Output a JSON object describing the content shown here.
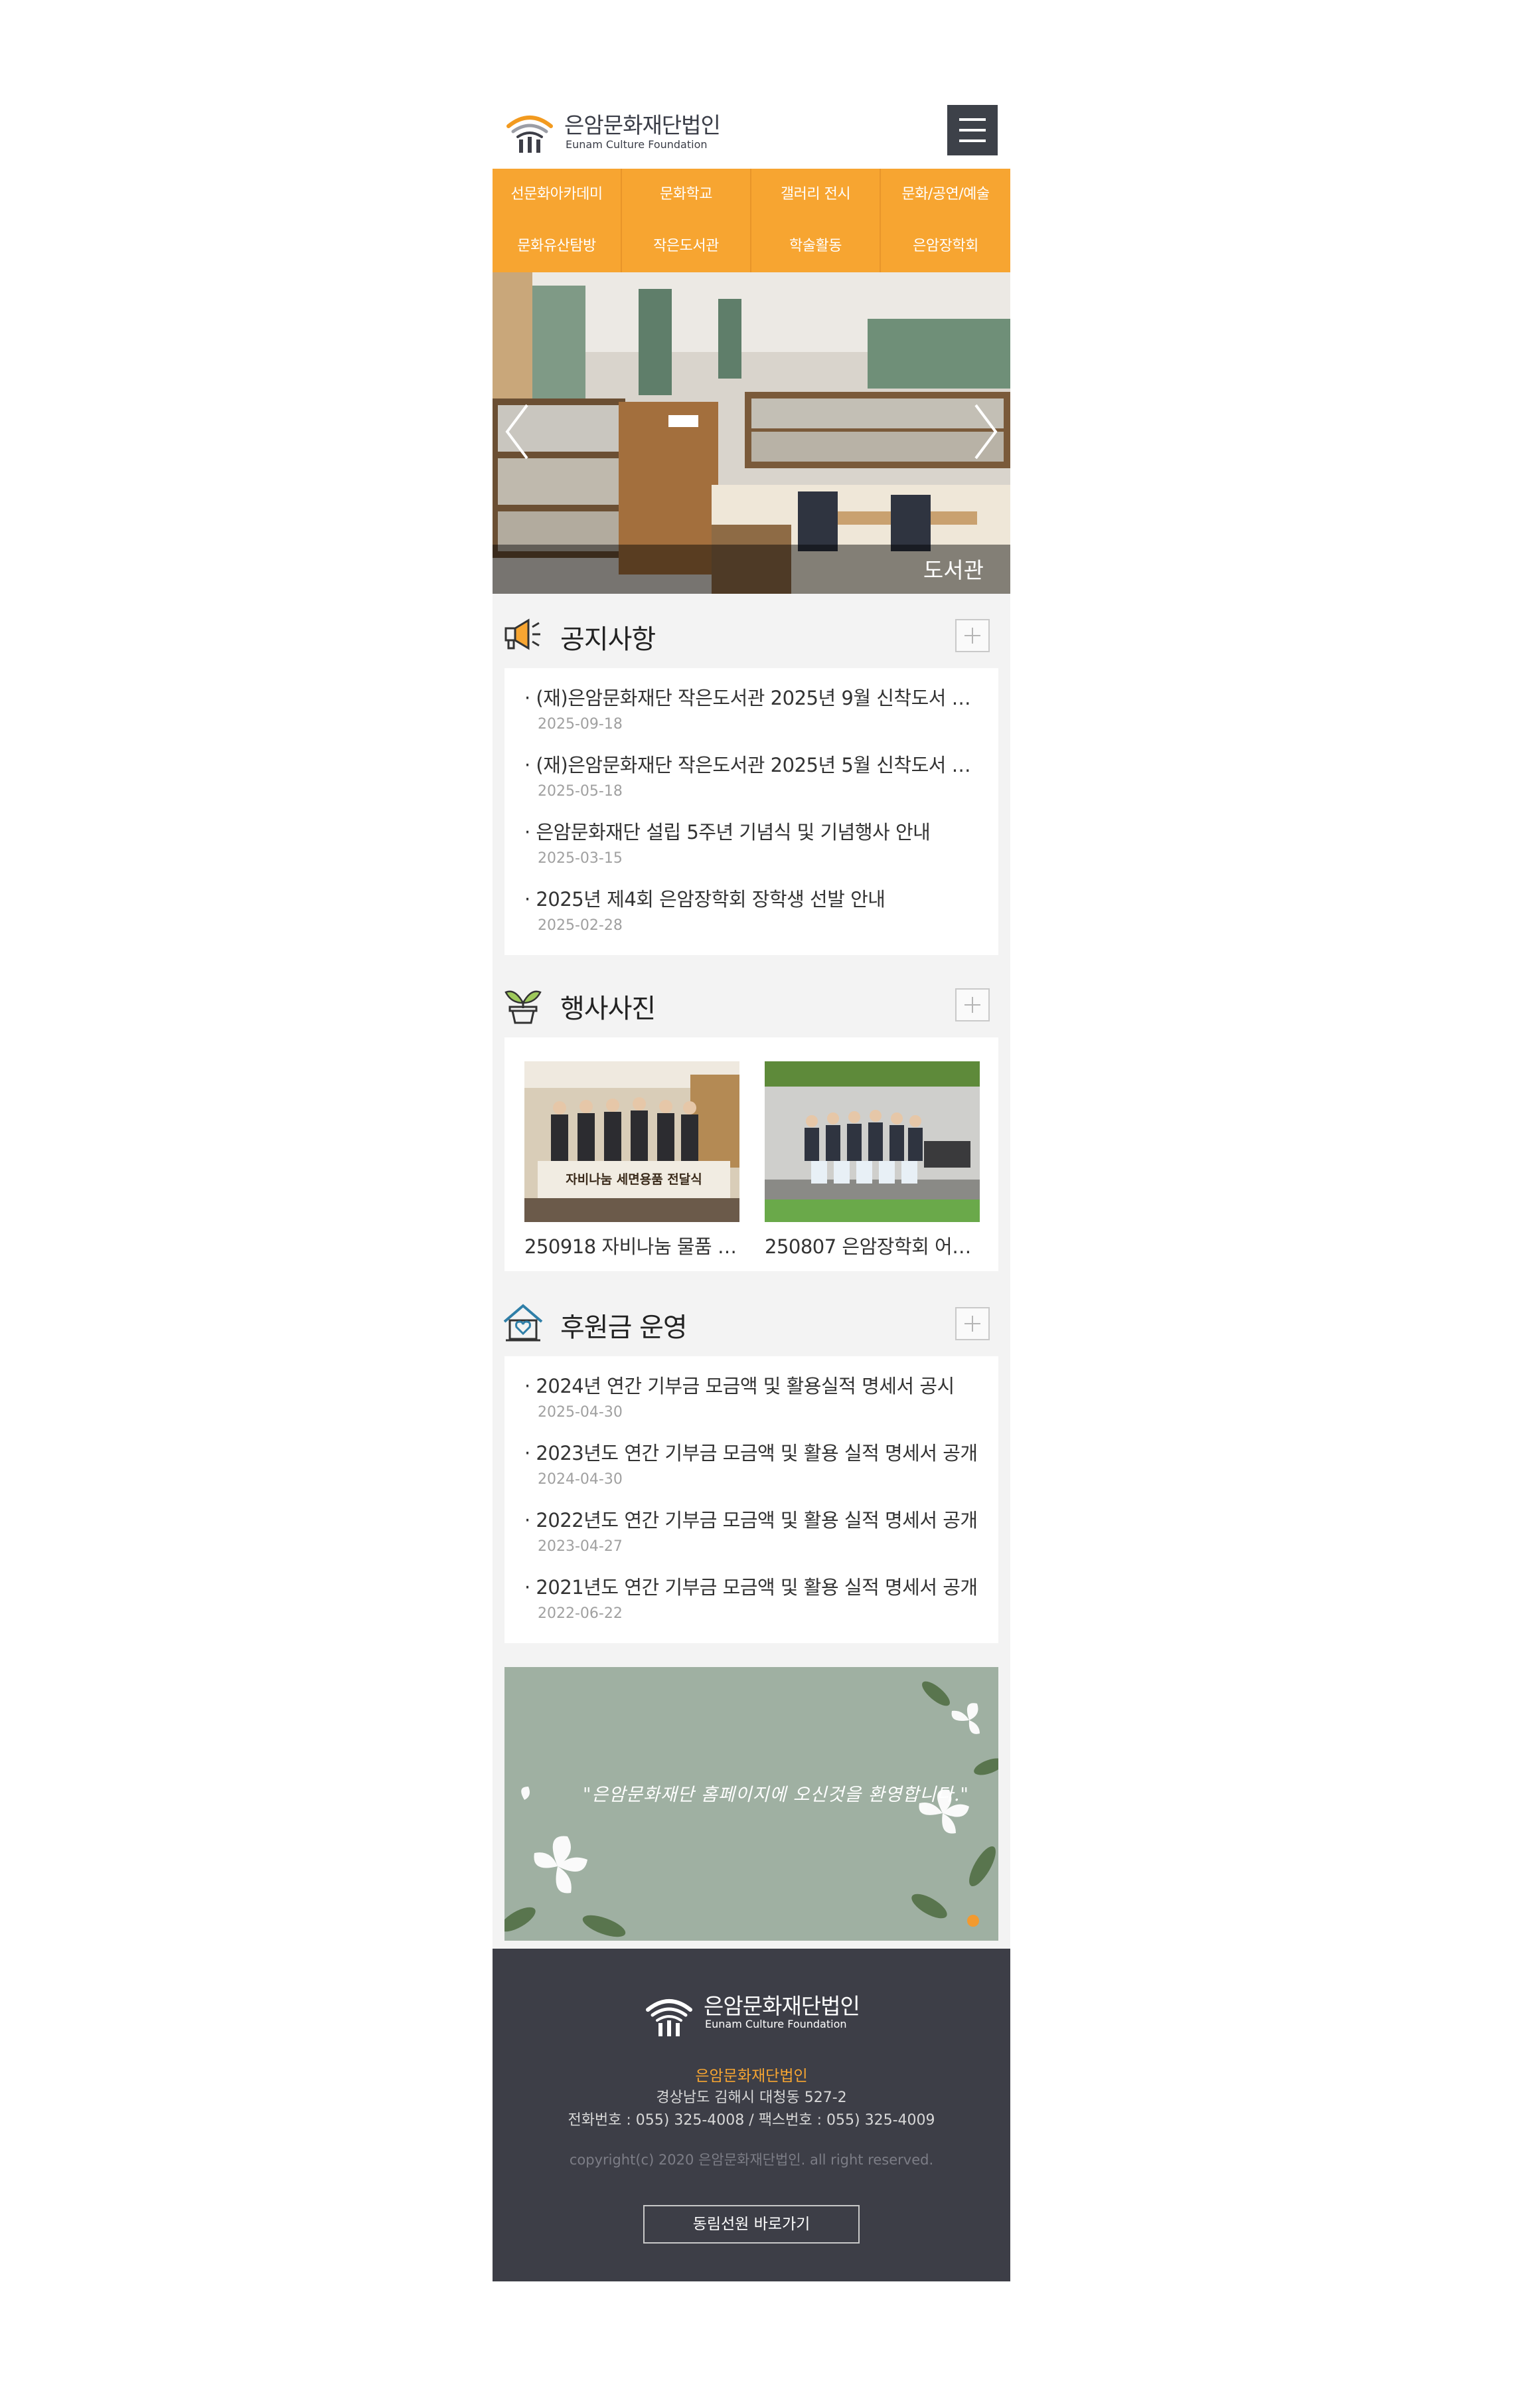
{
  "header": {
    "logo_title": "은암문화재단법인",
    "logo_subtitle": "Eunam Culture Foundation"
  },
  "nav": {
    "items": [
      "선문화아카데미",
      "문화학교",
      "갤러리 전시",
      "문화/공연/예술",
      "문화유산탐방",
      "작은도서관",
      "학술활동",
      "은암장학회"
    ]
  },
  "slider": {
    "caption": "도서관"
  },
  "notice": {
    "title": "공지사항",
    "posts": [
      {
        "title": "· (재)은암문화재단 작은도서관 2025년 9월 신착도서 …",
        "date": "2025-09-18"
      },
      {
        "title": "· (재)은암문화재단 작은도서관 2025년 5월 신착도서 …",
        "date": "2025-05-18"
      },
      {
        "title": "· 은암문화재단 설립 5주년 기념식 및 기념행사 안내",
        "date": "2025-03-15"
      },
      {
        "title": "· 2025년 제4회 은암장학회 장학생 선발 안내",
        "date": "2025-02-28"
      }
    ]
  },
  "gallery": {
    "title": "행사사진",
    "items": [
      {
        "caption": "250918 자비나눔 물품 …",
        "banner_text": "자비나눔 세면용품 전달식"
      },
      {
        "caption": "250807 은암장학회 어…"
      }
    ]
  },
  "donation": {
    "title": "후원금 운영",
    "posts": [
      {
        "title": "· 2024년 연간 기부금 모금액 및 활용실적 명세서 공시",
        "date": "2025-04-30"
      },
      {
        "title": "· 2023년도 연간 기부금 모금액 및 활용 실적 명세서 공개",
        "date": "2024-04-30"
      },
      {
        "title": "· 2022년도 연간 기부금 모금액 및 활용 실적 명세서 공개",
        "date": "2023-04-27"
      },
      {
        "title": "· 2021년도 연간 기부금 모금액 및 활용 실적 명세서 공개",
        "date": "2022-06-22"
      }
    ]
  },
  "banner": {
    "message": "\"은암문화재단 홈페이지에 오신것을 환영합니다.\""
  },
  "footer": {
    "logo_title": "은암문화재단법인",
    "logo_subtitle": "Eunam Culture Foundation",
    "org_name": "은암문화재단법인",
    "address": "경상남도 김해시 대청동 527-2",
    "contact": "전화번호 : 055) 325-4008 / 팩스번호 : 055) 325-4009",
    "copyright": "copyright(c) 2020 은암문화재단법인. all right reserved.",
    "link_button": "동림선원 바로가기"
  },
  "colors": {
    "accent": "#f7a531",
    "dark": "#3d3e47",
    "page_bg": "#f3f3f3"
  }
}
